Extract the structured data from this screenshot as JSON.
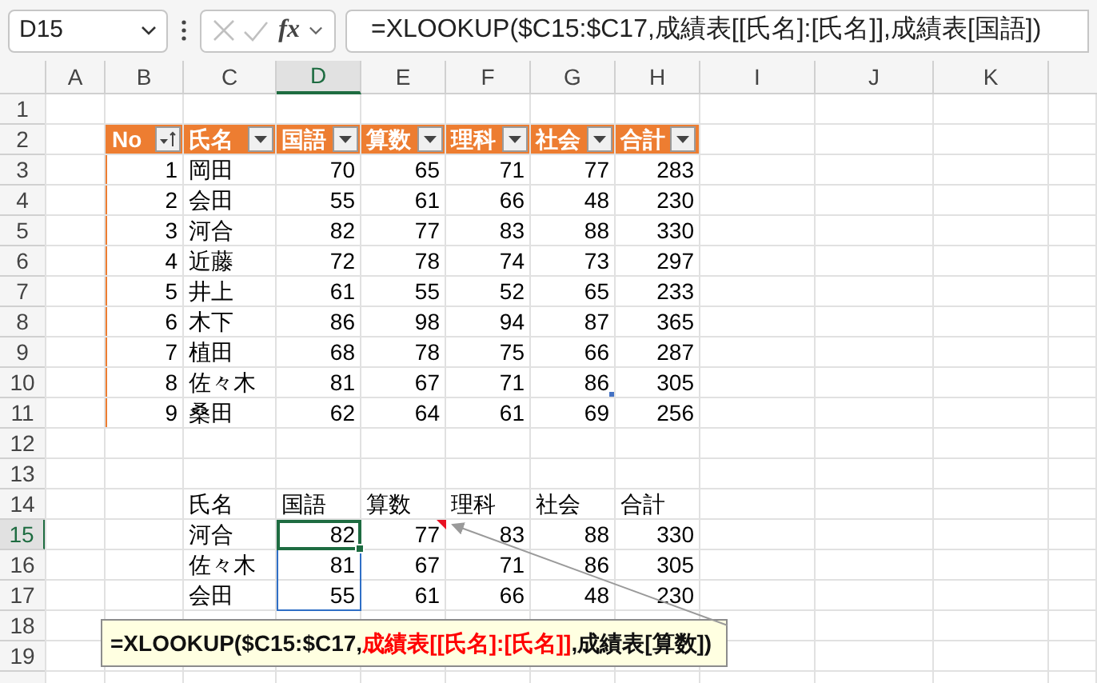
{
  "name_box": "D15",
  "function_button": "fx",
  "formula": "=XLOOKUP($C15:$C17,成績表[[氏名]:[氏名]],成績表[国語])",
  "columns": [
    {
      "label": "A",
      "selected": false
    },
    {
      "label": "B",
      "selected": false
    },
    {
      "label": "C",
      "selected": false
    },
    {
      "label": "D",
      "selected": true
    },
    {
      "label": "E",
      "selected": false
    },
    {
      "label": "F",
      "selected": false
    },
    {
      "label": "G",
      "selected": false
    },
    {
      "label": "H",
      "selected": false
    },
    {
      "label": "I",
      "selected": false
    },
    {
      "label": "J",
      "selected": false
    },
    {
      "label": "K",
      "selected": false
    }
  ],
  "rows": [
    {
      "label": "1",
      "selected": false
    },
    {
      "label": "2",
      "selected": false
    },
    {
      "label": "3",
      "selected": false
    },
    {
      "label": "4",
      "selected": false
    },
    {
      "label": "5",
      "selected": false
    },
    {
      "label": "6",
      "selected": false
    },
    {
      "label": "7",
      "selected": false
    },
    {
      "label": "8",
      "selected": false
    },
    {
      "label": "9",
      "selected": false
    },
    {
      "label": "10",
      "selected": false
    },
    {
      "label": "11",
      "selected": false
    },
    {
      "label": "12",
      "selected": false
    },
    {
      "label": "13",
      "selected": false
    },
    {
      "label": "14",
      "selected": false
    },
    {
      "label": "15",
      "selected": true
    },
    {
      "label": "16",
      "selected": false
    },
    {
      "label": "17",
      "selected": false
    },
    {
      "label": "18",
      "selected": false
    },
    {
      "label": "19",
      "selected": false
    }
  ],
  "score_table": {
    "header": [
      {
        "label": "No",
        "kind": "sorted"
      },
      {
        "label": "氏名",
        "kind": "filter"
      },
      {
        "label": "国語",
        "kind": "filter"
      },
      {
        "label": "算数",
        "kind": "filter"
      },
      {
        "label": "理科",
        "kind": "filter"
      },
      {
        "label": "社会",
        "kind": "filter"
      },
      {
        "label": "合計",
        "kind": "filter"
      }
    ],
    "rows": [
      [
        "1",
        "岡田",
        "70",
        "65",
        "71",
        "77",
        "283"
      ],
      [
        "2",
        "会田",
        "55",
        "61",
        "66",
        "48",
        "230"
      ],
      [
        "3",
        "河合",
        "82",
        "77",
        "83",
        "88",
        "330"
      ],
      [
        "4",
        "近藤",
        "72",
        "78",
        "74",
        "73",
        "297"
      ],
      [
        "5",
        "井上",
        "61",
        "55",
        "52",
        "65",
        "233"
      ],
      [
        "6",
        "木下",
        "86",
        "98",
        "94",
        "87",
        "365"
      ],
      [
        "7",
        "植田",
        "68",
        "78",
        "75",
        "66",
        "287"
      ],
      [
        "8",
        "佐々木",
        "81",
        "67",
        "71",
        "86",
        "305"
      ],
      [
        "9",
        "桑田",
        "62",
        "64",
        "61",
        "69",
        "256"
      ]
    ]
  },
  "lookup": {
    "header": [
      "氏名",
      "国語",
      "算数",
      "理科",
      "社会",
      "合計"
    ],
    "rows": [
      [
        "河合",
        "82",
        "77",
        "83",
        "88",
        "330"
      ],
      [
        "佐々木",
        "81",
        "67",
        "71",
        "86",
        "305"
      ],
      [
        "会田",
        "55",
        "61",
        "66",
        "48",
        "230"
      ]
    ]
  },
  "comment": {
    "segments": [
      {
        "text": "=XLOOKUP($C15:$C17,",
        "highlight": false
      },
      {
        "text": "成績表[[氏名]:[氏名]]",
        "highlight": true
      },
      {
        "text": ",成績表[算数])",
        "highlight": false
      }
    ]
  }
}
